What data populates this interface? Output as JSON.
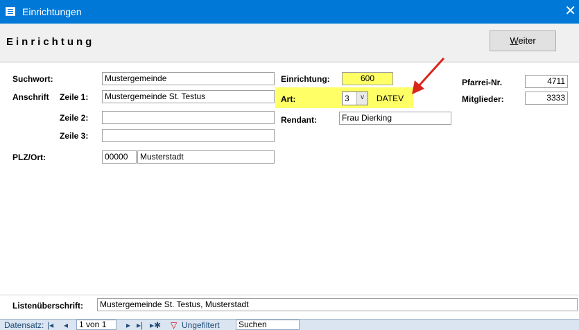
{
  "window": {
    "title": "Einrichtungen",
    "close_glyph": "✕"
  },
  "form": {
    "title": "Einrichtung",
    "weiter_first": "W",
    "weiter_rest": "eiter"
  },
  "fields": {
    "suchwort": {
      "label": "Suchwort:",
      "value": "Mustergemeinde"
    },
    "anschrift": {
      "label": "Anschrift",
      "zeile1_label": "Zeile 1:",
      "zeile1": "Mustergemeinde St. Testus",
      "zeile2_label": "Zeile 2:",
      "zeile2": "",
      "zeile3_label": "Zeile 3:",
      "zeile3": ""
    },
    "plzort": {
      "label": "PLZ/Ort:",
      "plz": "00000",
      "ort": "Musterstadt"
    },
    "einrichtung": {
      "label": "Einrichtung:",
      "value": "600"
    },
    "art": {
      "label": "Art:",
      "value": "3",
      "text": "DATEV"
    },
    "rendant": {
      "label": "Rendant:",
      "value": "Frau Dierking"
    },
    "pfarrei": {
      "label": "Pfarrei-Nr.",
      "value": "4711"
    },
    "mitglieder": {
      "label": "Mitglieder:",
      "value": "3333"
    },
    "listen": {
      "label": "Listenüberschrift:",
      "value": "Mustergemeinde St. Testus, Musterstadt"
    }
  },
  "navbar": {
    "prefix": "Datensatz:",
    "first": "|◂",
    "prev": "◂",
    "position": "1 von 1",
    "next": "▸",
    "last": "▸|",
    "new": "▸✱",
    "filter": "Ungefiltert",
    "search": "Suchen"
  },
  "colors": {
    "titlebar": "#0078d7",
    "highlight": "#ffff66",
    "arrow": "#d9261c"
  },
  "icons": {
    "window": "form-icon",
    "filter": "funnel-icon"
  }
}
